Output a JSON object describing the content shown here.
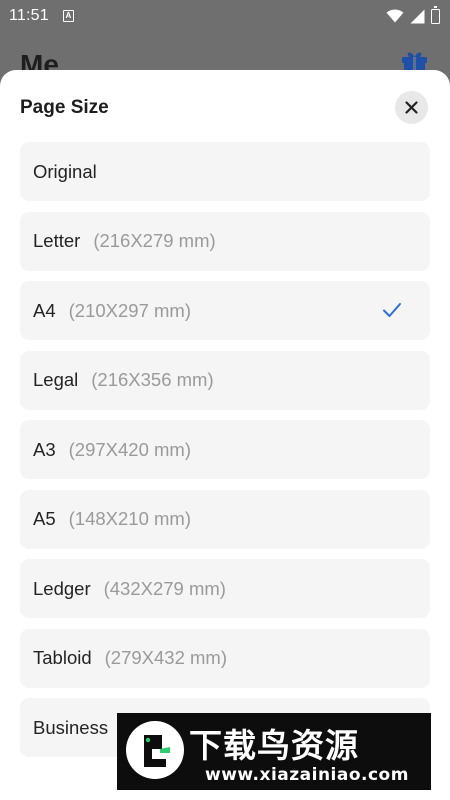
{
  "status_bar": {
    "time": "11:51",
    "notification_icon": "a-square-icon",
    "right_icons": [
      "wifi-icon",
      "signal-icon",
      "battery-charging-icon"
    ]
  },
  "background_page": {
    "title": "Me",
    "gift_icon": "gift-icon",
    "gift_color": "#1f4fa6"
  },
  "sheet": {
    "title": "Page Size",
    "close_icon": "close-icon",
    "accent_color": "#2f6fd6",
    "items": [
      {
        "name": "Original",
        "dimensions": "",
        "selected": false
      },
      {
        "name": "Letter",
        "dimensions": "(216X279 mm)",
        "selected": false
      },
      {
        "name": "A4",
        "dimensions": "(210X297 mm)",
        "selected": true
      },
      {
        "name": "Legal",
        "dimensions": "(216X356 mm)",
        "selected": false
      },
      {
        "name": "A3",
        "dimensions": "(297X420 mm)",
        "selected": false
      },
      {
        "name": "A5",
        "dimensions": "(148X210 mm)",
        "selected": false
      },
      {
        "name": "Ledger",
        "dimensions": "(432X279 mm)",
        "selected": false
      },
      {
        "name": "Tabloid",
        "dimensions": "(279X432 mm)",
        "selected": false
      },
      {
        "name": "Business",
        "dimensions": "",
        "selected": false
      }
    ]
  },
  "watermark": {
    "title": "下载鸟资源",
    "url": "www.xiazainiao.com"
  }
}
